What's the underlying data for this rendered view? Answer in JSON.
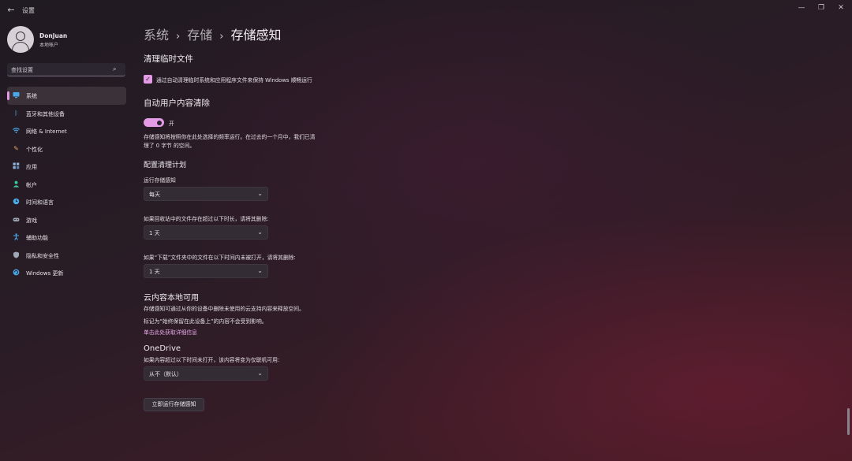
{
  "window": {
    "title": "设置",
    "controls": {
      "minimize": "—",
      "restore": "❐",
      "close": "✕"
    }
  },
  "user": {
    "name": "DonJuan",
    "account_type": "本地帐户"
  },
  "search": {
    "placeholder": "查找设置"
  },
  "sidebar": {
    "items": [
      {
        "label": "系统",
        "icon": "monitor-icon",
        "color": "#4aa8e8",
        "active": true
      },
      {
        "label": "蓝牙和其他设备",
        "icon": "bluetooth-icon",
        "color": "#4aa8e8"
      },
      {
        "label": "网络 & Internet",
        "icon": "wifi-icon",
        "color": "#4aa8e8"
      },
      {
        "label": "个性化",
        "icon": "brush-icon",
        "color": "#e0a060"
      },
      {
        "label": "应用",
        "icon": "apps-icon",
        "color": "#8fb4d8"
      },
      {
        "label": "帐户",
        "icon": "account-icon",
        "color": "#3fc2a0"
      },
      {
        "label": "时间和语言",
        "icon": "globe-clock-icon",
        "color": "#4aa8e8"
      },
      {
        "label": "游戏",
        "icon": "gamepad-icon",
        "color": "#a0a8b8"
      },
      {
        "label": "辅助功能",
        "icon": "accessibility-icon",
        "color": "#4aa8e8"
      },
      {
        "label": "隐私和安全性",
        "icon": "shield-icon",
        "color": "#a0a8b8"
      },
      {
        "label": "Windows 更新",
        "icon": "update-icon",
        "color": "#4aa8e8"
      }
    ]
  },
  "breadcrumb": {
    "part1": "系统",
    "part2": "存储",
    "current": "存储感知"
  },
  "temp_files": {
    "heading": "清理临时文件",
    "checkbox_label": "通过自动清理临时系统和应用程序文件来保持 Windows 顺畅运行",
    "checked": true
  },
  "auto_cleanup": {
    "heading": "自动用户内容清除",
    "toggle_state": "开",
    "toggle_on": true,
    "description_line1": "存储感知将按照你在此处选择的频率运行。在过去的一个月中，我们已清",
    "description_line2": "理了 0 字节 的空间。"
  },
  "schedule": {
    "heading": "配置清理计划",
    "run_label": "运行存储感知",
    "run_value": "每天",
    "recycle_label": "如果回收站中的文件存在超过以下时长，请将其删除:",
    "recycle_value": "1 天",
    "downloads_label": "如果“下载”文件夹中的文件在以下时间内未被打开，请将其删除:",
    "downloads_value": "1 天"
  },
  "cloud": {
    "heading": "云内容本地可用",
    "line1": "存储感知可通过从你的设备中删除未使用的云支持内容来释放空间。",
    "line2": "标记为“始终保留在此设备上”的内容不会受到影响。",
    "link": "单击此处获取详细信息"
  },
  "onedrive": {
    "heading": "OneDrive",
    "label": "如果内容超过以下时间未打开，该内容将变为仅联机可用:",
    "value": "从不（默认）"
  },
  "run_now_button": "立即运行存储感知",
  "accent_color": "#e39be6"
}
